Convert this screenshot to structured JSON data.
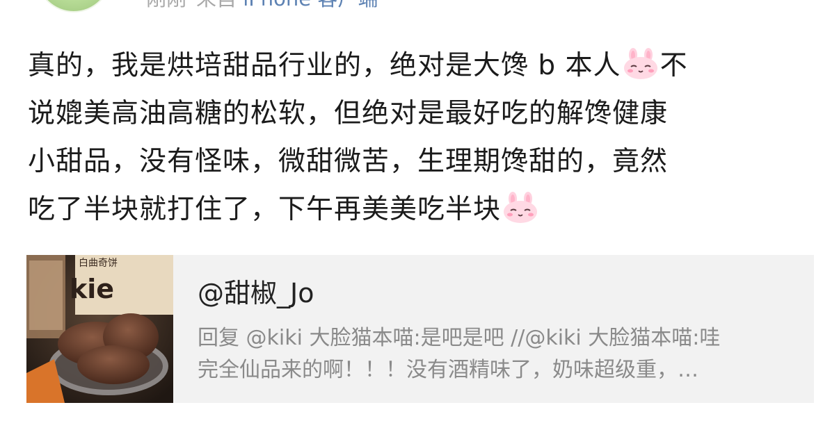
{
  "header": {
    "time": "刚刚",
    "source_prefix": "来自",
    "source_client": "iPhone 客户端"
  },
  "post": {
    "lines": [
      {
        "before": "真的，我是烘培甜品行业的，绝对是大馋 b 本人",
        "emoji": "bunny-blush-emoji",
        "after": "不"
      },
      {
        "before": "说媲美高油高糖的松软，但绝对是最好吃的解馋健康",
        "emoji": "",
        "after": ""
      },
      {
        "before": "小甜品，没有怪味，微甜微苦，生理期馋甜的，竟然",
        "emoji": "",
        "after": ""
      },
      {
        "before": "吃了半块就打住了，下午再美美吃半块",
        "emoji": "bunny-blush-emoji",
        "after": ""
      }
    ]
  },
  "repost": {
    "user": "@甜椒_Jo",
    "text_line1": "回复 @kiki 大脸猫本喵:是吧是吧 //@kiki 大脸猫本喵:哇",
    "text_line2": "完全仙品来的啊！！！没有酒精味了，奶味超级重，…",
    "thumbnail_label_top": "白曲奇饼",
    "thumbnail_label_brand": "kie"
  },
  "colors": {
    "text": "#1b1b1b",
    "meta": "#a8a8a8",
    "link": "#5d82b3",
    "card_bg": "#f2f2f2",
    "card_text": "#8a8a8a"
  }
}
